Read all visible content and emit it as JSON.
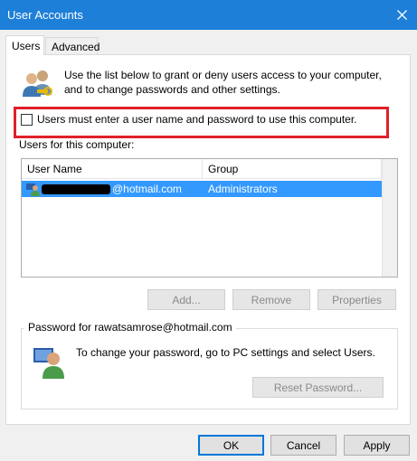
{
  "window": {
    "title": "User Accounts"
  },
  "tabs": [
    {
      "label": "Users",
      "active": true
    },
    {
      "label": "Advanced",
      "active": false
    }
  ],
  "intro": {
    "text": "Use the list below to grant or deny users access to your computer, and to change passwords and other settings."
  },
  "checkbox": {
    "label": "Users must enter a user name and password to use this computer.",
    "checked": false
  },
  "users_list": {
    "label": "Users for this computer:",
    "columns": [
      "User Name",
      "Group"
    ],
    "rows": [
      {
        "user_name_suffix": "@hotmail.com",
        "group": "Administrators",
        "selected": true
      }
    ]
  },
  "list_buttons": {
    "add": "Add...",
    "remove": "Remove",
    "properties": "Properties"
  },
  "password_group": {
    "title": "Password for rawatsamrose@hotmail.com",
    "text": "To change your password, go to PC settings and select Users.",
    "reset_button": "Reset Password..."
  },
  "footer": {
    "ok": "OK",
    "cancel": "Cancel",
    "apply": "Apply"
  },
  "colors": {
    "titlebar": "#1e7fd8",
    "selection": "#3399ff",
    "highlight_border": "#e0202a"
  }
}
